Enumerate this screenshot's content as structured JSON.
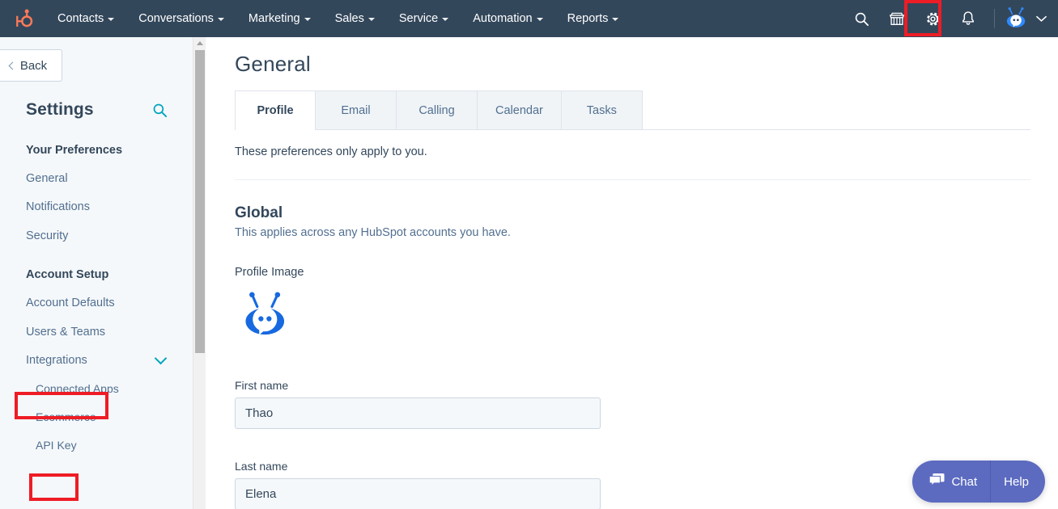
{
  "topnav": {
    "logo_name": "hubspot-sprocket-logo",
    "brand_color": "#ff7a59",
    "background": "#33475b",
    "menu": [
      {
        "label": "Contacts"
      },
      {
        "label": "Conversations"
      },
      {
        "label": "Marketing"
      },
      {
        "label": "Sales"
      },
      {
        "label": "Service"
      },
      {
        "label": "Automation"
      },
      {
        "label": "Reports"
      }
    ],
    "icons": [
      {
        "name": "search-icon"
      },
      {
        "name": "marketplace-icon"
      },
      {
        "name": "settings-gear-icon",
        "highlighted": true
      },
      {
        "name": "notifications-bell-icon"
      }
    ],
    "avatar_name": "user-avatar-bot",
    "avatar_chevron": "chevron-down-icon"
  },
  "annotations": {
    "highlight_color": "#ee1c25",
    "boxes": [
      {
        "target": "settings-gear-icon"
      },
      {
        "target": "sidebar-item-integrations"
      },
      {
        "target": "sidebar-item-api-key"
      }
    ]
  },
  "sidebar": {
    "back_label": "Back",
    "title": "Settings",
    "search_icon": "search-icon",
    "accent_color": "#00a4bd",
    "groups": [
      {
        "label": "Your Preferences",
        "items": [
          {
            "label": "General",
            "level": 1
          },
          {
            "label": "Notifications",
            "level": 1
          },
          {
            "label": "Security",
            "level": 1
          }
        ]
      },
      {
        "label": "Account Setup",
        "items": [
          {
            "label": "Account Defaults",
            "level": 1
          },
          {
            "label": "Users & Teams",
            "level": 1
          },
          {
            "label": "Integrations",
            "level": 1,
            "expanded": true,
            "chevron": "chevron-down-icon"
          },
          {
            "label": "Connected Apps",
            "level": 2
          },
          {
            "label": "Ecommerce",
            "level": 2
          },
          {
            "label": "API Key",
            "level": 2
          }
        ]
      }
    ],
    "scrollbar": {
      "name": "sidebar-scrollbar"
    }
  },
  "main": {
    "page_title": "General",
    "tabs": [
      {
        "label": "Profile",
        "active": true
      },
      {
        "label": "Email",
        "active": false
      },
      {
        "label": "Calling",
        "active": false
      },
      {
        "label": "Calendar",
        "active": false
      },
      {
        "label": "Tasks",
        "active": false
      }
    ],
    "intro_text": "These preferences only apply to you.",
    "section": {
      "title": "Global",
      "subtitle": "This applies across any HubSpot accounts you have."
    },
    "profile_image": {
      "label": "Profile Image",
      "avatar_name": "profile-avatar-bot",
      "color": "#1769e0"
    },
    "fields": [
      {
        "label": "First name",
        "value": "Thao",
        "placeholder": "First name"
      },
      {
        "label": "Last name",
        "value": "Elena",
        "placeholder": "Last name"
      }
    ]
  },
  "chat_widget": {
    "chat_label": "Chat",
    "help_label": "Help",
    "color": "#5c6bc0",
    "chat_icon": "chat-bubble-icon"
  }
}
